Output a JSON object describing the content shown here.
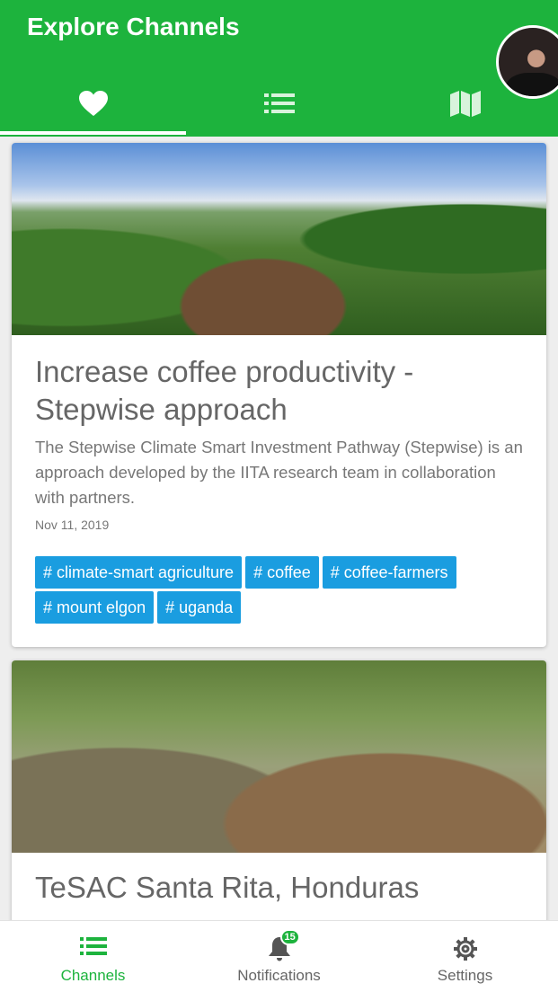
{
  "app": {
    "title": "Explore Channels",
    "accent_color": "#1db33d",
    "tag_color": "#1a9de0"
  },
  "top_tabs": [
    {
      "icon": "heart-icon",
      "active": true
    },
    {
      "icon": "list-icon",
      "active": false
    },
    {
      "icon": "map-icon",
      "active": false
    }
  ],
  "cards": [
    {
      "title": "Increase coffee productivity - Stepwise approach",
      "description": "The Stepwise Climate Smart Investment Pathway (Stepwise) is an approach developed by the IITA research team in collaboration with partners.",
      "date": "Nov 11, 2019",
      "tags": [
        "# climate-smart agriculture",
        "# coffee",
        "# coffee-farmers",
        "# mount elgon",
        "# uganda"
      ]
    },
    {
      "title": "TeSAC Santa Rita, Honduras"
    }
  ],
  "bottom_nav": {
    "channels": {
      "label": "Channels",
      "icon": "list-icon",
      "active": true
    },
    "notifications": {
      "label": "Notifications",
      "icon": "bell-icon",
      "badge": "15"
    },
    "settings": {
      "label": "Settings",
      "icon": "gear-icon"
    }
  }
}
